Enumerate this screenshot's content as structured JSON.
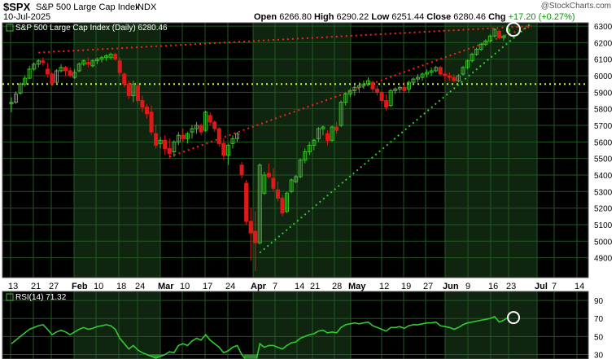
{
  "header": {
    "symbol": "$SPX",
    "name": "S&P 500 Large Cap Index",
    "exchange": "INDX",
    "date": "10-Jul-2025",
    "open_label": "Open",
    "open": "6266.80",
    "high_label": "High",
    "high": "6290.22",
    "low_label": "Low",
    "low": "6251.44",
    "close_label": "Close",
    "close": "6280.46",
    "chg_label": "Chg",
    "chg": "+17.20 (+0.27%)",
    "credit": "@StockCharts.com"
  },
  "colors": {
    "background": "#000000",
    "grid": "#1f5a1f",
    "shade": "#102510",
    "up": "#3bbf2a",
    "down": "#e01818",
    "axis_text": "#000000",
    "red_trend": "#ff2020",
    "green_trend": "#36c836",
    "rsi_line": "#2ecc2e"
  },
  "chart_data": [
    {
      "type": "candlestick",
      "title": "S&P 500 Large Cap Index (Daily) 6280.46",
      "ylim": [
        4780,
        6320
      ],
      "y_ticks": [
        4900,
        5000,
        5100,
        5200,
        5300,
        5400,
        5500,
        5600,
        5700,
        5800,
        5900,
        6000,
        6100,
        6200,
        6300
      ],
      "x_tick_labels": [
        "13",
        "21",
        "27",
        "Feb",
        "10",
        "18",
        "24",
        "Mar",
        "10",
        "17",
        "24",
        "Apr",
        "7",
        "14",
        "21",
        "28",
        "May",
        "12",
        "19",
        "27",
        "Jun",
        "9",
        "16",
        "23",
        "Jul",
        "7",
        "14"
      ],
      "horizontal_line": 5950,
      "candles": [
        [
          5830,
          5870,
          5780,
          5840
        ],
        [
          5840,
          5905,
          5830,
          5890
        ],
        [
          5895,
          5960,
          5885,
          5950
        ],
        [
          5950,
          6000,
          5935,
          5985
        ],
        [
          5985,
          6060,
          5980,
          6040
        ],
        [
          6040,
          6080,
          6030,
          6070
        ],
        [
          6070,
          6100,
          6050,
          6090
        ],
        [
          6090,
          6110,
          6060,
          6080
        ],
        [
          6040,
          6080,
          5990,
          6010
        ],
        [
          6010,
          6020,
          5940,
          5950
        ],
        [
          5960,
          6040,
          5950,
          6030
        ],
        [
          6030,
          6070,
          6020,
          6050
        ],
        [
          6050,
          6060,
          6000,
          6030
        ],
        [
          6030,
          6050,
          5990,
          6000
        ],
        [
          5990,
          6040,
          5980,
          6020
        ],
        [
          6030,
          6080,
          6020,
          6070
        ],
        [
          6070,
          6100,
          6060,
          6090
        ],
        [
          6080,
          6110,
          6050,
          6070
        ],
        [
          6060,
          6100,
          6050,
          6090
        ],
        [
          6090,
          6110,
          6070,
          6100
        ],
        [
          6100,
          6120,
          6080,
          6110
        ],
        [
          6110,
          6130,
          6090,
          6120
        ],
        [
          6110,
          6140,
          6100,
          6130
        ],
        [
          6130,
          6140,
          6090,
          6100
        ],
        [
          6090,
          6110,
          6000,
          6020
        ],
        [
          6010,
          6020,
          5930,
          5950
        ],
        [
          5950,
          5970,
          5860,
          5880
        ],
        [
          5880,
          5970,
          5840,
          5950
        ],
        [
          5940,
          5960,
          5830,
          5850
        ],
        [
          5850,
          5880,
          5780,
          5810
        ],
        [
          5810,
          5830,
          5740,
          5770
        ],
        [
          5780,
          5820,
          5640,
          5660
        ],
        [
          5650,
          5700,
          5560,
          5580
        ],
        [
          5590,
          5630,
          5560,
          5610
        ],
        [
          5610,
          5640,
          5520,
          5560
        ],
        [
          5560,
          5620,
          5500,
          5530
        ],
        [
          5540,
          5610,
          5510,
          5600
        ],
        [
          5600,
          5660,
          5580,
          5640
        ],
        [
          5640,
          5680,
          5600,
          5620
        ],
        [
          5620,
          5660,
          5590,
          5650
        ],
        [
          5660,
          5700,
          5620,
          5680
        ],
        [
          5680,
          5720,
          5650,
          5700
        ],
        [
          5700,
          5710,
          5640,
          5660
        ],
        [
          5670,
          5790,
          5660,
          5780
        ],
        [
          5760,
          5780,
          5700,
          5720
        ],
        [
          5720,
          5730,
          5660,
          5680
        ],
        [
          5680,
          5690,
          5570,
          5590
        ],
        [
          5590,
          5620,
          5490,
          5520
        ],
        [
          5520,
          5590,
          5460,
          5580
        ],
        [
          5590,
          5640,
          5560,
          5620
        ],
        [
          5620,
          5660,
          5600,
          5650
        ],
        [
          5460,
          5480,
          5380,
          5400
        ],
        [
          5350,
          5370,
          5100,
          5120
        ],
        [
          5120,
          5200,
          4880,
          5050
        ],
        [
          5060,
          5180,
          4820,
          4990
        ],
        [
          4990,
          5470,
          4980,
          5460
        ],
        [
          5290,
          5420,
          5280,
          5400
        ],
        [
          5410,
          5470,
          5380,
          5390
        ],
        [
          5380,
          5440,
          5300,
          5320
        ],
        [
          5310,
          5360,
          5240,
          5260
        ],
        [
          5260,
          5280,
          5150,
          5170
        ],
        [
          5180,
          5300,
          5170,
          5290
        ],
        [
          5300,
          5380,
          5290,
          5370
        ],
        [
          5360,
          5400,
          5350,
          5390
        ],
        [
          5390,
          5500,
          5380,
          5490
        ],
        [
          5490,
          5560,
          5470,
          5540
        ],
        [
          5540,
          5600,
          5520,
          5580
        ],
        [
          5580,
          5620,
          5550,
          5610
        ],
        [
          5620,
          5690,
          5600,
          5680
        ],
        [
          5680,
          5700,
          5640,
          5690
        ],
        [
          5650,
          5670,
          5580,
          5610
        ],
        [
          5610,
          5700,
          5600,
          5690
        ],
        [
          5690,
          5720,
          5650,
          5670
        ],
        [
          5700,
          5850,
          5690,
          5840
        ],
        [
          5840,
          5900,
          5820,
          5890
        ],
        [
          5890,
          5920,
          5870,
          5910
        ],
        [
          5910,
          5950,
          5880,
          5930
        ],
        [
          5930,
          5960,
          5900,
          5940
        ],
        [
          5940,
          5970,
          5920,
          5950
        ],
        [
          5950,
          5990,
          5940,
          5970
        ],
        [
          5960,
          5970,
          5900,
          5920
        ],
        [
          5920,
          5940,
          5880,
          5900
        ],
        [
          5900,
          5910,
          5830,
          5850
        ],
        [
          5850,
          5890,
          5790,
          5810
        ],
        [
          5820,
          5920,
          5810,
          5910
        ],
        [
          5910,
          5930,
          5890,
          5920
        ],
        [
          5920,
          5940,
          5900,
          5930
        ],
        [
          5930,
          5960,
          5900,
          5910
        ],
        [
          5920,
          5970,
          5900,
          5960
        ],
        [
          5960,
          5990,
          5950,
          5980
        ],
        [
          5980,
          6010,
          5960,
          5990
        ],
        [
          5990,
          6020,
          5970,
          6010
        ],
        [
          6010,
          6040,
          5990,
          6020
        ],
        [
          6020,
          6050,
          6000,
          6030
        ],
        [
          6030,
          6060,
          6020,
          6050
        ],
        [
          6050,
          6060,
          6000,
          6010
        ],
        [
          6010,
          6030,
          5970,
          6000
        ],
        [
          6000,
          6020,
          5970,
          5990
        ],
        [
          5990,
          6010,
          5960,
          5970
        ],
        [
          5970,
          6010,
          5960,
          6000
        ],
        [
          6010,
          6060,
          6000,
          6050
        ],
        [
          6050,
          6100,
          6040,
          6090
        ],
        [
          6090,
          6140,
          6080,
          6130
        ],
        [
          6130,
          6170,
          6120,
          6160
        ],
        [
          6160,
          6200,
          6150,
          6190
        ],
        [
          6190,
          6220,
          6180,
          6210
        ],
        [
          6210,
          6250,
          6200,
          6240
        ],
        [
          6240,
          6290,
          6230,
          6280
        ],
        [
          6270,
          6280,
          6220,
          6230
        ],
        [
          6230,
          6250,
          6210,
          6240
        ],
        [
          6266.8,
          6290.22,
          6251.44,
          6280.46
        ]
      ],
      "trendlines": [
        {
          "color": "red",
          "style": "dotted",
          "from": [
            6,
            6140
          ],
          "to": [
            113,
            6300
          ]
        },
        {
          "color": "red",
          "style": "dotted",
          "from": [
            35,
            5510
          ],
          "to": [
            113,
            6300
          ]
        },
        {
          "color": "green",
          "style": "dotted",
          "from": [
            55,
            4930
          ],
          "to": [
            113,
            6260
          ]
        }
      ],
      "highlight_circle": [
        111,
        6280
      ]
    },
    {
      "type": "line",
      "title": "RSI(14) 71.32",
      "series": [
        {
          "name": "RSI(14)",
          "values": [
            42,
            46,
            50,
            54,
            58,
            60,
            62,
            63,
            58,
            52,
            55,
            57,
            55,
            52,
            55,
            58,
            60,
            58,
            59,
            61,
            62,
            63,
            62,
            58,
            48,
            42,
            36,
            40,
            35,
            32,
            30,
            28,
            26,
            28,
            30,
            33,
            32,
            40,
            42,
            40,
            45,
            48,
            46,
            52,
            46,
            42,
            38,
            32,
            34,
            38,
            40,
            30,
            24,
            19,
            18,
            42,
            38,
            40,
            40,
            38,
            36,
            40,
            43,
            44,
            48,
            50,
            52,
            53,
            56,
            57,
            54,
            55,
            54,
            60,
            63,
            64,
            65,
            64,
            65,
            66,
            62,
            60,
            58,
            56,
            60,
            60,
            61,
            59,
            62,
            63,
            63,
            64,
            65,
            65,
            66,
            62,
            61,
            60,
            58,
            60,
            63,
            65,
            66,
            67,
            68,
            69,
            70,
            72,
            66,
            68,
            71.32
          ]
        }
      ],
      "ylim": [
        25,
        100
      ],
      "y_ticks": [
        30,
        50,
        70,
        90
      ],
      "highlight_circle": [
        111,
        71
      ]
    }
  ]
}
